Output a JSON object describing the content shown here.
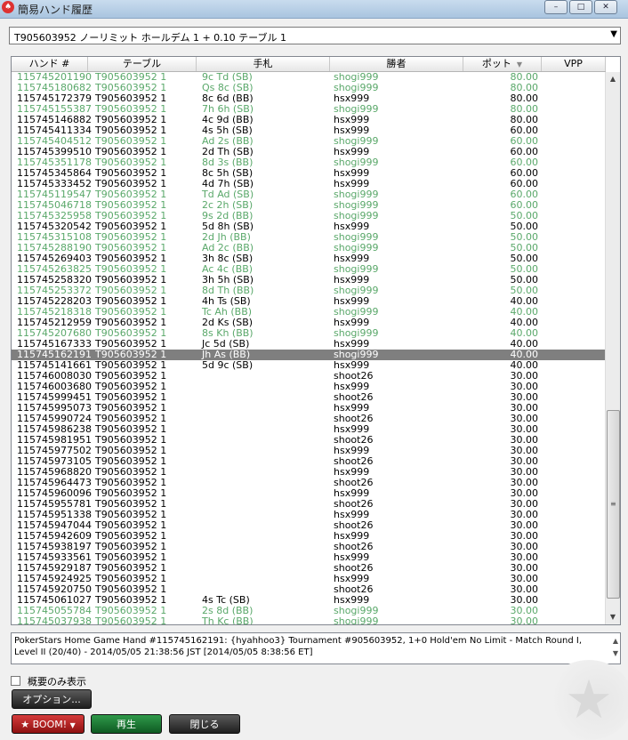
{
  "window": {
    "title": "簡易ハンド履歴",
    "icon": "pokerstars-icon",
    "controls": [
      "–",
      "□",
      "✕"
    ]
  },
  "table_select": {
    "value": "T905603952 ノーリミット ホールデム 1 + 0.10 テーブル 1"
  },
  "columns": {
    "hand": "ハンド #",
    "table": "テーブル",
    "cards": "手札",
    "winner": "勝者",
    "pot": "ポット",
    "vpp": "VPP"
  },
  "rows": [
    {
      "hand": "115745201190",
      "table": "T905603952 1",
      "cards": "9c Td (SB)",
      "winner": "shogi999",
      "pot": "80.00",
      "style": "green"
    },
    {
      "hand": "115745180682",
      "table": "T905603952 1",
      "cards": "Qs 8c (SB)",
      "winner": "shogi999",
      "pot": "80.00",
      "style": "green"
    },
    {
      "hand": "115745172379",
      "table": "T905603952 1",
      "cards": "8c 6d (BB)",
      "winner": "hsx999",
      "pot": "80.00",
      "style": "normal"
    },
    {
      "hand": "115745155387",
      "table": "T905603952 1",
      "cards": "7h 6h (SB)",
      "winner": "shogi999",
      "pot": "80.00",
      "style": "green"
    },
    {
      "hand": "115745146882",
      "table": "T905603952 1",
      "cards": "4c 9d (BB)",
      "winner": "hsx999",
      "pot": "80.00",
      "style": "normal"
    },
    {
      "hand": "115745411334",
      "table": "T905603952 1",
      "cards": "4s 5h (SB)",
      "winner": "hsx999",
      "pot": "60.00",
      "style": "normal"
    },
    {
      "hand": "115745404512",
      "table": "T905603952 1",
      "cards": "Ad 2s (BB)",
      "winner": "shogi999",
      "pot": "60.00",
      "style": "green"
    },
    {
      "hand": "115745399510",
      "table": "T905603952 1",
      "cards": "2d Th (SB)",
      "winner": "hsx999",
      "pot": "60.00",
      "style": "normal"
    },
    {
      "hand": "115745351178",
      "table": "T905603952 1",
      "cards": "8d 3s (BB)",
      "winner": "shogi999",
      "pot": "60.00",
      "style": "green"
    },
    {
      "hand": "115745345864",
      "table": "T905603952 1",
      "cards": "8c 5h (SB)",
      "winner": "hsx999",
      "pot": "60.00",
      "style": "normal"
    },
    {
      "hand": "115745333452",
      "table": "T905603952 1",
      "cards": "4d 7h (SB)",
      "winner": "hsx999",
      "pot": "60.00",
      "style": "normal"
    },
    {
      "hand": "115745119547",
      "table": "T905603952 1",
      "cards": "Td Ad (SB)",
      "winner": "shogi999",
      "pot": "60.00",
      "style": "green"
    },
    {
      "hand": "115745046718",
      "table": "T905603952 1",
      "cards": "2c 2h (SB)",
      "winner": "shogi999",
      "pot": "60.00",
      "style": "green"
    },
    {
      "hand": "115745325958",
      "table": "T905603952 1",
      "cards": "9s 2d (BB)",
      "winner": "shogi999",
      "pot": "50.00",
      "style": "green"
    },
    {
      "hand": "115745320542",
      "table": "T905603952 1",
      "cards": "5d 8h (SB)",
      "winner": "hsx999",
      "pot": "50.00",
      "style": "normal"
    },
    {
      "hand": "115745315108",
      "table": "T905603952 1",
      "cards": "2d Jh (BB)",
      "winner": "shogi999",
      "pot": "50.00",
      "style": "green"
    },
    {
      "hand": "115745288190",
      "table": "T905603952 1",
      "cards": "Ad 2c (BB)",
      "winner": "shogi999",
      "pot": "50.00",
      "style": "green"
    },
    {
      "hand": "115745269403",
      "table": "T905603952 1",
      "cards": "3h 8c (SB)",
      "winner": "hsx999",
      "pot": "50.00",
      "style": "normal"
    },
    {
      "hand": "115745263825",
      "table": "T905603952 1",
      "cards": "Ac 4c (BB)",
      "winner": "shogi999",
      "pot": "50.00",
      "style": "green"
    },
    {
      "hand": "115745258320",
      "table": "T905603952 1",
      "cards": "3h 5h (SB)",
      "winner": "hsx999",
      "pot": "50.00",
      "style": "normal"
    },
    {
      "hand": "115745253372",
      "table": "T905603952 1",
      "cards": "8d Th (BB)",
      "winner": "shogi999",
      "pot": "50.00",
      "style": "green"
    },
    {
      "hand": "115745228203",
      "table": "T905603952 1",
      "cards": "4h Ts (SB)",
      "winner": "hsx999",
      "pot": "40.00",
      "style": "normal"
    },
    {
      "hand": "115745218318",
      "table": "T905603952 1",
      "cards": "Tc Ah (BB)",
      "winner": "shogi999",
      "pot": "40.00",
      "style": "green"
    },
    {
      "hand": "115745212959",
      "table": "T905603952 1",
      "cards": "2d Ks (SB)",
      "winner": "hsx999",
      "pot": "40.00",
      "style": "normal"
    },
    {
      "hand": "115745207680",
      "table": "T905603952 1",
      "cards": "8s Kh (BB)",
      "winner": "shogi999",
      "pot": "40.00",
      "style": "green"
    },
    {
      "hand": "115745167333",
      "table": "T905603952 1",
      "cards": "Jc 5d (SB)",
      "winner": "hsx999",
      "pot": "40.00",
      "style": "normal"
    },
    {
      "hand": "115745162191",
      "table": "T905603952 1",
      "cards": "Jh As (BB)",
      "winner": "shogi999",
      "pot": "40.00",
      "style": "selected"
    },
    {
      "hand": "115745141661",
      "table": "T905603952 1",
      "cards": "5d 9c (SB)",
      "winner": "hsx999",
      "pot": "40.00",
      "style": "normal"
    },
    {
      "hand": "115746008030",
      "table": "T905603952 1",
      "cards": "",
      "winner": "shoot26",
      "pot": "30.00",
      "style": "normal"
    },
    {
      "hand": "115746003680",
      "table": "T905603952 1",
      "cards": "",
      "winner": "hsx999",
      "pot": "30.00",
      "style": "normal"
    },
    {
      "hand": "115745999451",
      "table": "T905603952 1",
      "cards": "",
      "winner": "shoot26",
      "pot": "30.00",
      "style": "normal"
    },
    {
      "hand": "115745995073",
      "table": "T905603952 1",
      "cards": "",
      "winner": "hsx999",
      "pot": "30.00",
      "style": "normal"
    },
    {
      "hand": "115745990724",
      "table": "T905603952 1",
      "cards": "",
      "winner": "shoot26",
      "pot": "30.00",
      "style": "normal"
    },
    {
      "hand": "115745986238",
      "table": "T905603952 1",
      "cards": "",
      "winner": "hsx999",
      "pot": "30.00",
      "style": "normal"
    },
    {
      "hand": "115745981951",
      "table": "T905603952 1",
      "cards": "",
      "winner": "shoot26",
      "pot": "30.00",
      "style": "normal"
    },
    {
      "hand": "115745977502",
      "table": "T905603952 1",
      "cards": "",
      "winner": "hsx999",
      "pot": "30.00",
      "style": "normal"
    },
    {
      "hand": "115745973105",
      "table": "T905603952 1",
      "cards": "",
      "winner": "shoot26",
      "pot": "30.00",
      "style": "normal"
    },
    {
      "hand": "115745968820",
      "table": "T905603952 1",
      "cards": "",
      "winner": "hsx999",
      "pot": "30.00",
      "style": "normal"
    },
    {
      "hand": "115745964473",
      "table": "T905603952 1",
      "cards": "",
      "winner": "shoot26",
      "pot": "30.00",
      "style": "normal"
    },
    {
      "hand": "115745960096",
      "table": "T905603952 1",
      "cards": "",
      "winner": "hsx999",
      "pot": "30.00",
      "style": "normal"
    },
    {
      "hand": "115745955781",
      "table": "T905603952 1",
      "cards": "",
      "winner": "shoot26",
      "pot": "30.00",
      "style": "normal"
    },
    {
      "hand": "115745951338",
      "table": "T905603952 1",
      "cards": "",
      "winner": "hsx999",
      "pot": "30.00",
      "style": "normal"
    },
    {
      "hand": "115745947044",
      "table": "T905603952 1",
      "cards": "",
      "winner": "shoot26",
      "pot": "30.00",
      "style": "normal"
    },
    {
      "hand": "115745942609",
      "table": "T905603952 1",
      "cards": "",
      "winner": "hsx999",
      "pot": "30.00",
      "style": "normal"
    },
    {
      "hand": "115745938197",
      "table": "T905603952 1",
      "cards": "",
      "winner": "shoot26",
      "pot": "30.00",
      "style": "normal"
    },
    {
      "hand": "115745933561",
      "table": "T905603952 1",
      "cards": "",
      "winner": "hsx999",
      "pot": "30.00",
      "style": "normal"
    },
    {
      "hand": "115745929187",
      "table": "T905603952 1",
      "cards": "",
      "winner": "shoot26",
      "pot": "30.00",
      "style": "normal"
    },
    {
      "hand": "115745924925",
      "table": "T905603952 1",
      "cards": "",
      "winner": "hsx999",
      "pot": "30.00",
      "style": "normal"
    },
    {
      "hand": "115745920750",
      "table": "T905603952 1",
      "cards": "",
      "winner": "shoot26",
      "pot": "30.00",
      "style": "normal"
    },
    {
      "hand": "115745061027",
      "table": "T905603952 1",
      "cards": "4s Tc (SB)",
      "winner": "hsx999",
      "pot": "30.00",
      "style": "normal"
    },
    {
      "hand": "115745055784",
      "table": "T905603952 1",
      "cards": "2s 8d (BB)",
      "winner": "shogi999",
      "pot": "30.00",
      "style": "green"
    },
    {
      "hand": "115745037938",
      "table": "T905603952 1",
      "cards": "Th Kc (BB)",
      "winner": "shogi999",
      "pot": "30.00",
      "style": "green"
    }
  ],
  "detail_text": "PokerStars Home Game Hand #115745162191: {hyahhoo3} Tournament #905603952, 1+0 Hold'em No Limit - Match Round I, Level II (20/40) - 2014/05/05 21:38:56 JST [2014/05/05 8:38:56 ET]",
  "summary_only": {
    "label": "概要のみ表示",
    "checked": false
  },
  "buttons": {
    "options": "オプション...",
    "boom": "BOOM!",
    "play": "再生",
    "close": "閉じる"
  },
  "colors": {
    "green_row": "#5aa86a",
    "selected_row": "#7f7f7f",
    "boom_button": "#c62828",
    "play_button": "#1f7a36"
  }
}
